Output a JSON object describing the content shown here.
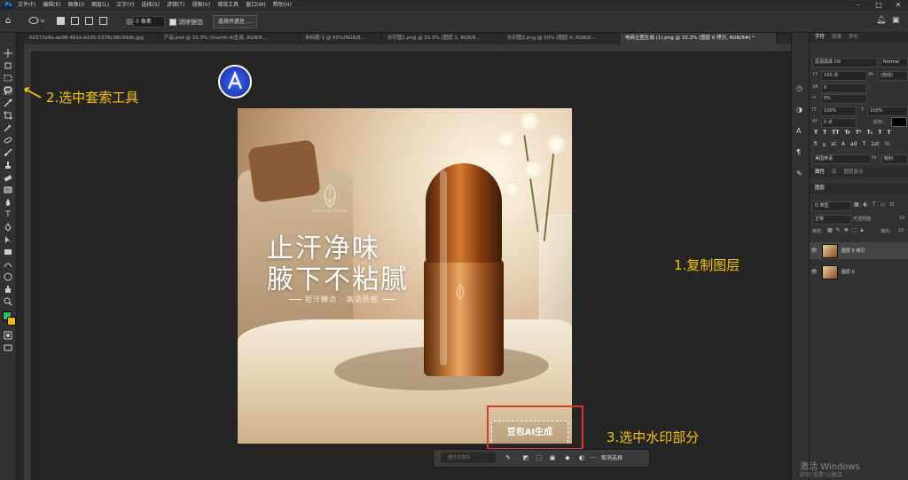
{
  "app": {
    "logo": "Ps"
  },
  "menu": [
    "文件(F)",
    "编辑(E)",
    "图像(I)",
    "图层(L)",
    "文字(Y)",
    "选择(S)",
    "滤镜(T)",
    "视图(V)",
    "增效工具",
    "窗口(W)",
    "帮助(H)"
  ],
  "options": {
    "feather_label": "羽化:",
    "feather_value": "0 像素",
    "antialias_label": "消除锯齿",
    "select_mask_label": "选择并遮住 ..."
  },
  "tabs": [
    {
      "label": "62573e9a-ab98-461e-b195-0378c96c99db.jpg",
      "active": false
    },
    {
      "label": "产品.psd @ 33.3% (StartAI AI生成, RGB/8...",
      "active": false
    },
    {
      "label": "未标题-1 @ 50%(RGB/8...",
      "active": false
    },
    {
      "label": "水印图1.png @ 33.3% (图层 1, RGB/8...",
      "active": false
    },
    {
      "label": "水印图2.png @ 50% (图层 0, RGB/8...",
      "active": false
    },
    {
      "label": "电商主图生成 (1).png @ 33.3% (图层 0 拷贝, RGB/8#) *",
      "active": true
    }
  ],
  "artwork": {
    "headline_line1": "止汗净味",
    "headline_line2": "腋下不粘腻",
    "tagline": "拒汗糖点 · 高语质感",
    "brand_name": "SOVILIBELTHEIEN",
    "watermark": "豆包AI生成"
  },
  "annotations": {
    "step1": "1.复制图层",
    "step2": "2.选中套索工具",
    "step3": "3.选中水印部分"
  },
  "context_bar": {
    "prompt_placeholder": "描述式填充",
    "cancel_label": "取消选择",
    "more": "···"
  },
  "character_panel": {
    "tabs": [
      "字符",
      "段落",
      "字形"
    ],
    "font_family": "思源黑体 CN",
    "font_style": "Normal",
    "font_size": "150 点",
    "leading": "(自动)",
    "kerning": "0",
    "tracking": "0%",
    "vscale": "100%",
    "hscale": "100%",
    "baseline": "0 点",
    "color_label": "颜色:",
    "type_buttons": [
      "T",
      "T",
      "TT",
      "Tr",
      "T¹",
      "T₁",
      "T",
      "T"
    ],
    "opentype_buttons": [
      "fi",
      "ꝺ",
      "st",
      "A",
      "ad",
      "T",
      "1st",
      "½"
    ],
    "language": "美国英语",
    "aa_mode": "锐利"
  },
  "properties_tabs": [
    "属性",
    "库",
    "图层复合"
  ],
  "layers_panel": {
    "title": "图层",
    "filter_kind": "Q 类型",
    "blend_mode": "正常",
    "opacity_label": "不透明度:",
    "opacity_value": "10",
    "lock_label": "锁定:",
    "fill_label": "填充:",
    "fill_value": "10",
    "layers": [
      {
        "name": "图层 0 拷贝",
        "selected": true
      },
      {
        "name": "图层 0",
        "selected": false
      }
    ]
  },
  "windows": {
    "activate_title": "激活 Windows",
    "activate_sub": "转到\"设置\"以激活"
  },
  "colors": {
    "foreground": "#22c55e",
    "background": "#f5b800",
    "annotation": "#f5c400",
    "annotation_box": "#d93b2b"
  }
}
